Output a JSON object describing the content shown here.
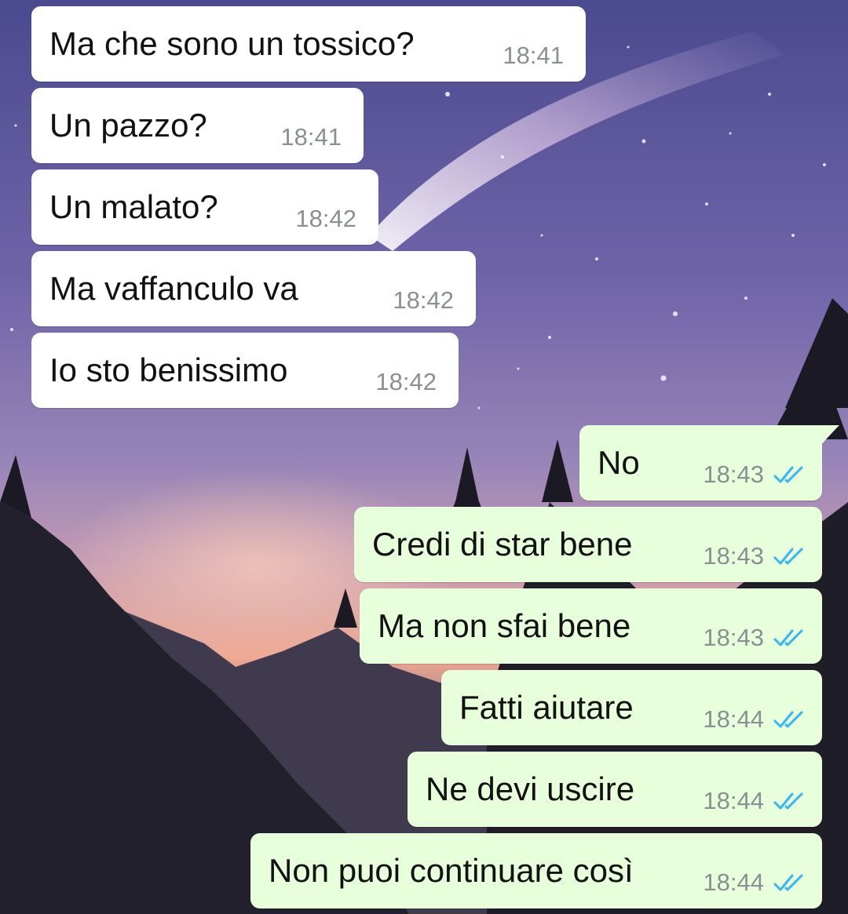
{
  "theme": {
    "incoming_bg": "#ffffff",
    "outgoing_bg": "#e7ffdb",
    "text_color": "#111111",
    "time_color": "#8a8f92",
    "read_check_color": "#34b7f1"
  },
  "wallpaper": {
    "description_icon": "night-sky-mountains-wallpaper"
  },
  "messages": [
    {
      "direction": "in",
      "text": "Ma che sono un tossico?",
      "time": "18:41"
    },
    {
      "direction": "in",
      "text": "Un pazzo?",
      "time": "18:41"
    },
    {
      "direction": "in",
      "text": "Un malato?",
      "time": "18:42"
    },
    {
      "direction": "in",
      "text": "Ma vaffanculo va",
      "time": "18:42"
    },
    {
      "direction": "in",
      "text": "Io sto benissimo",
      "time": "18:42"
    },
    {
      "direction": "out",
      "text": "No",
      "time": "18:43",
      "status_icon": "double-check-read-icon"
    },
    {
      "direction": "out",
      "text": "Credi di star bene",
      "time": "18:43",
      "status_icon": "double-check-read-icon"
    },
    {
      "direction": "out",
      "text": "Ma non sfai bene",
      "time": "18:43",
      "status_icon": "double-check-read-icon"
    },
    {
      "direction": "out",
      "text": "Fatti aiutare",
      "time": "18:44",
      "status_icon": "double-check-read-icon"
    },
    {
      "direction": "out",
      "text": "Ne devi uscire",
      "time": "18:44",
      "status_icon": "double-check-read-icon"
    },
    {
      "direction": "out",
      "text": "Non puoi continuare così",
      "time": "18:44",
      "status_icon": "double-check-read-icon"
    }
  ]
}
